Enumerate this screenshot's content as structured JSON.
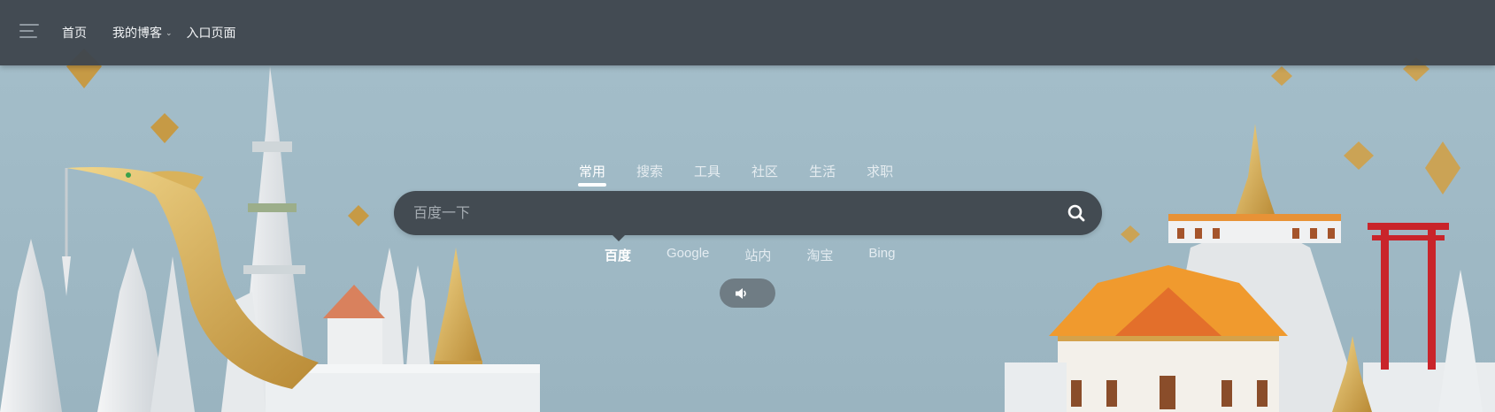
{
  "nav": {
    "items": [
      {
        "label": "首页"
      },
      {
        "label": "我的博客"
      },
      {
        "label": "入口页面"
      }
    ]
  },
  "search": {
    "tabs": [
      {
        "label": "常用",
        "active": true
      },
      {
        "label": "搜索",
        "active": false
      },
      {
        "label": "工具",
        "active": false
      },
      {
        "label": "社区",
        "active": false
      },
      {
        "label": "生活",
        "active": false
      },
      {
        "label": "求职",
        "active": false
      }
    ],
    "placeholder": "百度一下",
    "value": "",
    "engines": [
      {
        "label": "百度",
        "active": true
      },
      {
        "label": "Google",
        "active": false
      },
      {
        "label": "站内",
        "active": false
      },
      {
        "label": "淘宝",
        "active": false
      },
      {
        "label": "Bing",
        "active": false
      }
    ]
  },
  "icons": {
    "menu": "hamburger-menu-icon",
    "dropdown": "chevron-down-icon",
    "search": "search-icon",
    "sound": "speaker-icon"
  },
  "colors": {
    "topbar": "#3e464e",
    "search_bg": "#434b52",
    "sky": "#9eb8c4",
    "sound_btn": "#6f7c84"
  }
}
